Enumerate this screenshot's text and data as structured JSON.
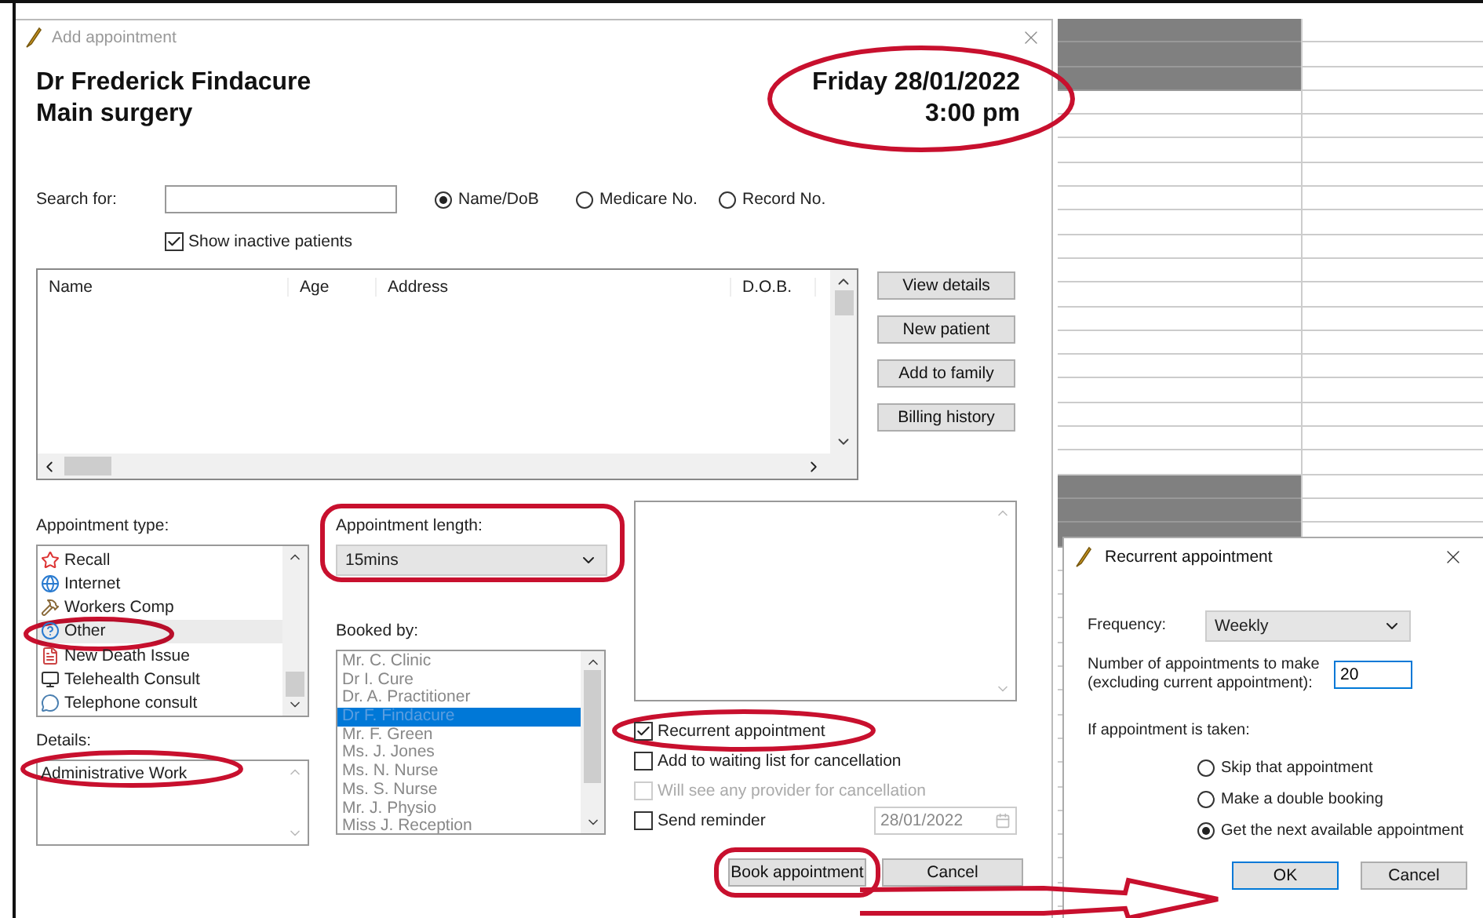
{
  "main_window": {
    "title": "Add appointment",
    "practitioner": "Dr Frederick Findacure",
    "location": "Main surgery",
    "date": "Friday 28/01/2022",
    "time": "3:00 pm",
    "date_circled": true,
    "search": {
      "label": "Search for:",
      "options": [
        {
          "label": "Name/DoB",
          "selected": true
        },
        {
          "label": "Medicare No.",
          "selected": false
        },
        {
          "label": "Record No.",
          "selected": false
        }
      ],
      "show_inactive": {
        "label": "Show inactive patients",
        "checked": true
      }
    },
    "patients_table": {
      "columns": [
        "Name",
        "Age",
        "Address",
        "D.O.B."
      ]
    },
    "side_buttons": [
      "View details",
      "New patient",
      "Add to family",
      "Billing history"
    ],
    "appointment_type": {
      "label": "Appointment type:",
      "items": [
        {
          "label": "Recall",
          "selected": false,
          "circled": false
        },
        {
          "label": "Internet",
          "selected": false,
          "circled": false
        },
        {
          "label": "Workers Comp",
          "selected": false,
          "circled": false
        },
        {
          "label": "Other",
          "selected": true,
          "circled": true
        },
        {
          "label": "New Death Issue",
          "selected": false,
          "circled": false
        },
        {
          "label": "Telehealth Consult",
          "selected": false,
          "circled": false
        },
        {
          "label": "Telephone consult",
          "selected": false,
          "circled": false
        }
      ]
    },
    "details": {
      "label": "Details:",
      "value": "Administrative Work",
      "circled": true
    },
    "appointment_length": {
      "label": "Appointment length:",
      "value": "15mins",
      "circled": true
    },
    "booked_by": {
      "label": "Booked by:",
      "disabled": true,
      "items": [
        {
          "label": "Mr. C. Clinic",
          "selected": false
        },
        {
          "label": "Dr I. Cure",
          "selected": false
        },
        {
          "label": "Dr. A. Practitioner",
          "selected": false
        },
        {
          "label": "Dr F. Findacure",
          "selected": true
        },
        {
          "label": "Mr. F. Green",
          "selected": false
        },
        {
          "label": "Ms. J. Jones",
          "selected": false
        },
        {
          "label": "Ms. N. Nurse",
          "selected": false
        },
        {
          "label": "Ms. S. Nurse",
          "selected": false
        },
        {
          "label": "Mr. J. Physio",
          "selected": false
        },
        {
          "label": "Miss J. Reception",
          "selected": false
        }
      ]
    },
    "options": [
      {
        "label": "Recurrent appointment",
        "checked": true,
        "disabled": false,
        "circled": true
      },
      {
        "label": "Add to waiting list for cancellation",
        "checked": false,
        "disabled": false,
        "circled": false
      },
      {
        "label": "Will see any provider for cancellation",
        "checked": false,
        "disabled": true,
        "circled": false
      },
      {
        "label": "Send reminder",
        "checked": false,
        "disabled": false,
        "circled": false
      }
    ],
    "reminder_date": {
      "value": "28/01/2022",
      "disabled": true
    },
    "buttons": [
      {
        "label": "Book appointment",
        "circled": true
      },
      {
        "label": "Cancel",
        "circled": false
      }
    ]
  },
  "schedule": {
    "slots": [
      {
        "unavailable": true
      },
      {
        "unavailable": true
      },
      {
        "unavailable": true
      },
      {
        "unavailable": false
      },
      {
        "unavailable": false
      },
      {
        "unavailable": false
      },
      {
        "unavailable": false
      },
      {
        "unavailable": false
      },
      {
        "unavailable": false
      },
      {
        "unavailable": false
      },
      {
        "unavailable": false
      },
      {
        "unavailable": false
      },
      {
        "unavailable": false
      },
      {
        "unavailable": false
      },
      {
        "unavailable": false
      },
      {
        "unavailable": false
      },
      {
        "unavailable": false
      },
      {
        "unavailable": false
      },
      {
        "unavailable": false
      },
      {
        "unavailable": true
      },
      {
        "unavailable": true
      },
      {
        "unavailable": true
      },
      {
        "unavailable": false
      },
      {
        "unavailable": false
      },
      {
        "unavailable": false
      },
      {
        "unavailable": false
      },
      {
        "unavailable": false
      },
      {
        "unavailable": false
      },
      {
        "unavailable": false
      },
      {
        "unavailable": false
      },
      {
        "unavailable": false
      },
      {
        "unavailable": false
      },
      {
        "unavailable": false
      },
      {
        "unavailable": false
      },
      {
        "unavailable": false
      },
      {
        "unavailable": false
      },
      {
        "unavailable": false
      },
      {
        "unavailable": false
      }
    ]
  },
  "recurrent_dialog": {
    "title": "Recurrent appointment",
    "frequency": {
      "label": "Frequency:",
      "value": "Weekly"
    },
    "count": {
      "label": "Number of appointments to make\n(excluding current appointment):",
      "value": "20"
    },
    "taken_label": "If appointment is taken:",
    "taken_options": [
      {
        "label": "Skip that appointment",
        "selected": false
      },
      {
        "label": "Make a double booking",
        "selected": false
      },
      {
        "label": "Get the next available appointment",
        "selected": true
      }
    ],
    "buttons": [
      {
        "label": "OK",
        "default": true
      },
      {
        "label": "Cancel",
        "default": false
      }
    ]
  },
  "annotation_arrow": true
}
